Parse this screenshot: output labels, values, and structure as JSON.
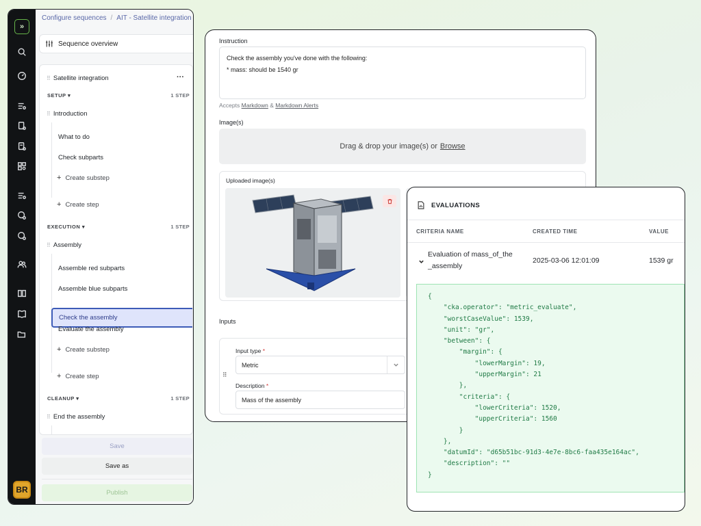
{
  "breadcrumb": {
    "parent": "Configure sequences",
    "current": "AIT - Satellite integration"
  },
  "sidebar": {
    "overview_label": "Sequence overview",
    "sequence_name": "Satellite integration",
    "sections": [
      {
        "name": "SETUP",
        "count": "1 STEP",
        "step": "Introduction",
        "substeps": [
          "What to do",
          "Check subparts"
        ],
        "create_substep": "Create substep",
        "create_step": "Create step"
      },
      {
        "name": "EXECUTION",
        "count": "1 STEP",
        "step": "Assembly",
        "substeps": [
          "Assemble red subparts",
          "Assemble blue subparts",
          "Check the assembly",
          "Evaluate the assembly"
        ],
        "create_substep": "Create substep",
        "create_step": "Create step"
      },
      {
        "name": "CLEANUP",
        "count": "1 STEP",
        "step": "End the assembly"
      }
    ],
    "selected_substep": "Check the assembly",
    "save_label": "Save",
    "save_as_label": "Save as",
    "publish_label": "Publish",
    "user_initials": "BR"
  },
  "editor": {
    "instruction_label": "Instruction",
    "instruction_line1": "Check the assembly you've done with the following:",
    "instruction_line2": "* mass: should be 1540 gr",
    "accepts_prefix": "Accepts",
    "accepts_link1": "Markdown",
    "accepts_amp": "&",
    "accepts_link2": "Markdown Alerts",
    "images_label": "Image(s)",
    "drop_text": "Drag & drop your image(s) or",
    "browse_label": "Browse",
    "uploaded_label": "Uploaded image(s)",
    "inputs_label": "Inputs",
    "input_type_label": "Input type",
    "input_type_value": "Metric",
    "description_label": "Description",
    "description_value": "Mass of the assembly",
    "required_mark": "*"
  },
  "evaluations": {
    "title": "EVALUATIONS",
    "columns": [
      "CRITERIA NAME",
      "CREATED TIME",
      "VALUE"
    ],
    "row": {
      "name_line1": "Evaluation of mass_of_the",
      "name_line2": "_assembly",
      "created": "2025-03-06 12:01:09",
      "value": "1539 gr"
    },
    "json_lines": [
      "{",
      "    \"cka.operator\": \"metric_evaluate\",",
      "    \"worstCaseValue\": 1539,",
      "    \"unit\": \"gr\",",
      "    \"between\": {",
      "        \"margin\": {",
      "            \"lowerMargin\": 19,",
      "            \"upperMargin\": 21",
      "        },",
      "        \"criteria\": {",
      "            \"lowerCriteria\": 1520,",
      "            \"upperCriteria\": 1560",
      "        }",
      "    },",
      "    \"datumId\": \"d65b51bc-91d3-4e7e-8bc6-faa435e164ac\",",
      "    \"description\": \"\"",
      "}"
    ]
  },
  "colors": {
    "accent": "#3c5bb7",
    "rail": "#111315",
    "json_text": "#1f7a45",
    "json_bg": "#ebfaef"
  }
}
